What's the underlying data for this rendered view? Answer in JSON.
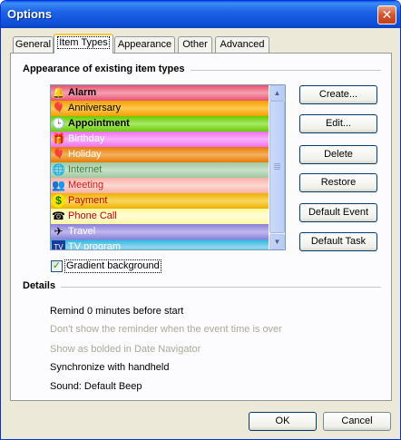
{
  "window": {
    "title": "Options",
    "close_glyph": "✕"
  },
  "tabs": [
    {
      "label": "General"
    },
    {
      "label": "Item Types"
    },
    {
      "label": "Appearance"
    },
    {
      "label": "Other"
    },
    {
      "label": "Advanced"
    }
  ],
  "appearance_group": {
    "title": "Appearance of existing item types",
    "items": [
      {
        "label": "Alarm",
        "bold": true,
        "gradient": [
          "#e85070",
          "#f4a0b0"
        ],
        "text_color": "#000000",
        "icon": "bell-icon",
        "glyph": "🔔"
      },
      {
        "label": "Anniversary",
        "bold": false,
        "gradient": [
          "#f0a000",
          "#ffc850"
        ],
        "text_color": "#000000",
        "icon": "balloons-icon",
        "glyph": "🎈"
      },
      {
        "label": "Appointment",
        "bold": true,
        "gradient": [
          "#66cc00",
          "#a8e868"
        ],
        "text_color": "#000000",
        "icon": "clock-icon",
        "glyph": "🕒"
      },
      {
        "label": "Birthday",
        "bold": false,
        "gradient": [
          "#f070f0",
          "#f8b0f8"
        ],
        "text_color": "#ffffff",
        "icon": "gift-icon",
        "glyph": "🎁"
      },
      {
        "label": "Holiday",
        "bold": false,
        "gradient": [
          "#e87a00",
          "#f4b060"
        ],
        "text_color": "#ffffff",
        "icon": "balloon-icon",
        "glyph": "🎈"
      },
      {
        "label": "Internet",
        "bold": false,
        "gradient": [
          "#a0c8a0",
          "#c8e0c8"
        ],
        "text_color": "#408040",
        "icon": "globe-icon",
        "glyph": "🌐"
      },
      {
        "label": "Meeting",
        "bold": false,
        "gradient": [
          "#f8b0a8",
          "#fcd8d0"
        ],
        "text_color": "#c02020",
        "icon": "people-icon",
        "glyph": "👥"
      },
      {
        "label": "Payment",
        "bold": false,
        "gradient": [
          "#f0b000",
          "#f8d860"
        ],
        "text_color": "#c00000",
        "icon": "dollar-icon",
        "glyph": "$"
      },
      {
        "label": "Phone Call",
        "bold": false,
        "gradient": [
          "#fff8a0",
          "#fffcd8"
        ],
        "text_color": "#c00000",
        "icon": "phone-icon",
        "glyph": "☎"
      },
      {
        "label": "Travel",
        "bold": false,
        "gradient": [
          "#8a80d8",
          "#c0b8f0"
        ],
        "text_color": "#ffffff",
        "icon": "airplane-icon",
        "glyph": "✈"
      },
      {
        "label": "TV program",
        "bold": false,
        "gradient": [
          "#30b0e0",
          "#90d8f0"
        ],
        "text_color": "#ffffff",
        "icon": "tv-icon",
        "glyph": "TV"
      }
    ]
  },
  "buttons": {
    "create": "Create...",
    "edit": "Edit...",
    "delete": "Delete",
    "restore": "Restore",
    "default_event": "Default Event",
    "default_task": "Default Task"
  },
  "gradient_checkbox": {
    "label": "Gradient background",
    "checked": true,
    "check_glyph": "✓"
  },
  "details_group": {
    "title": "Details",
    "lines": [
      {
        "text": "Remind 0 minutes before start",
        "enabled": true
      },
      {
        "text": "Don't show the reminder when the event time is over",
        "enabled": false
      },
      {
        "text": "Show as bolded in Date Navigator",
        "enabled": false
      },
      {
        "text": "Synchronize with handheld",
        "enabled": true
      },
      {
        "text": "Sound:  Default Beep",
        "enabled": true
      }
    ]
  },
  "footer": {
    "ok_label": "OK",
    "cancel_label": "Cancel"
  }
}
